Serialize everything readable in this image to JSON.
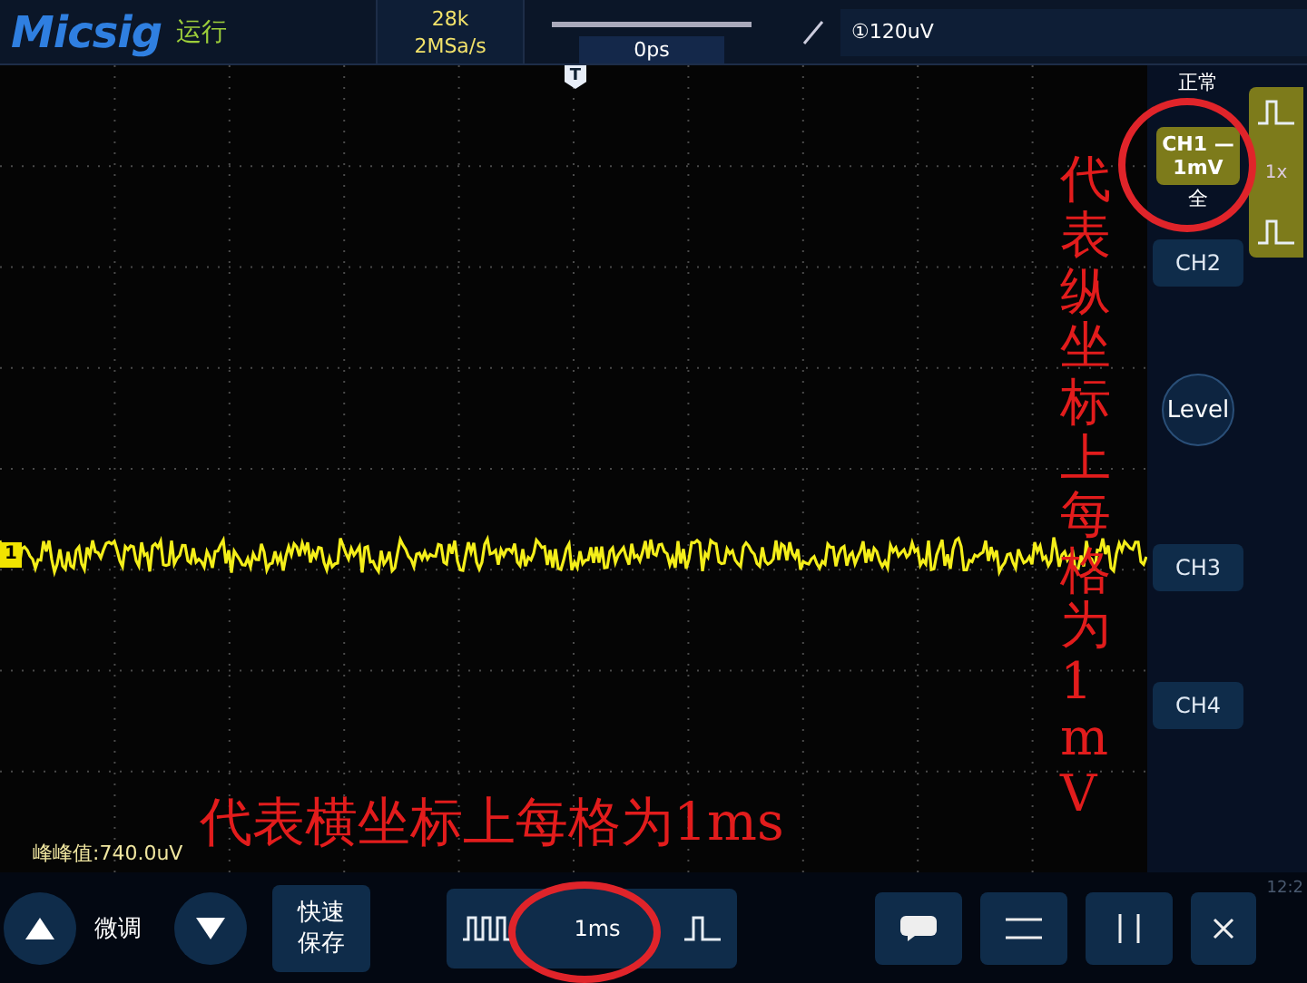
{
  "header": {
    "brand": "Micsig",
    "run_state": "运行",
    "memory_depth": "28k",
    "sample_rate": "2MSa/s",
    "trigger_position": "0ps",
    "trigger_level": "①120uV"
  },
  "plot": {
    "trigger_marker": "T",
    "channel_marker": "1",
    "measurement": "峰峰值:740.0uV"
  },
  "annotations": [
    {
      "kind": "vertical",
      "text": "代表纵坐标上每格为1mV"
    },
    {
      "kind": "horizontal",
      "text": "代表横坐标上每格为1ms"
    }
  ],
  "side_panel": {
    "acquire_mode": "正常",
    "bandwidth": "全",
    "probe": "1x",
    "level_button": "Level",
    "channels": [
      {
        "label": "CH1 —",
        "scale": "1mV",
        "selected": true
      },
      {
        "label": "CH2",
        "selected": false
      },
      {
        "label": "CH3",
        "selected": false
      },
      {
        "label": "CH4",
        "selected": false
      }
    ]
  },
  "bottom_bar": {
    "fine_tune": "微调",
    "quick_save": [
      "快速",
      "保存"
    ],
    "timebase": "1ms",
    "clock": "12:2"
  }
}
